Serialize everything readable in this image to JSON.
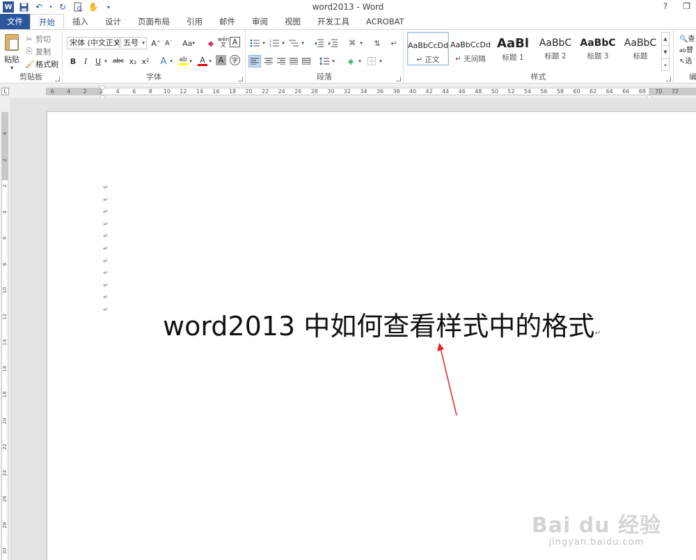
{
  "titlebar": {
    "title": "word2013 - Word",
    "help": "?",
    "restore": "❒",
    "qat_icons": [
      "word-logo",
      "save-icon",
      "undo-icon",
      "redo-icon",
      "print-preview-icon",
      "touch-mode-icon",
      "customize-qat-icon"
    ],
    "word_logo_text": "W"
  },
  "tabs": [
    "文件",
    "开始",
    "插入",
    "设计",
    "页面布局",
    "引用",
    "邮件",
    "审阅",
    "视图",
    "开发工具",
    "ACROBAT"
  ],
  "active_tab": "开始",
  "ribbon": {
    "clipboard": {
      "label": "剪贴板",
      "paste": "粘贴",
      "cut": "剪切",
      "copy": "复制",
      "format_painter": "格式刷"
    },
    "font": {
      "label": "字体",
      "font_name": "宋体 (中文正文",
      "font_size": "五号",
      "grow": "A",
      "shrink": "A",
      "change_case": "Aa",
      "bold": "B",
      "italic": "I",
      "underline": "U",
      "strikethrough": "abc",
      "subscript": "x₂",
      "superscript": "x²",
      "text_effects": "A",
      "highlight": "ab",
      "font_color": "A",
      "char_shading": "A",
      "enclose": "字",
      "phonetic": "wén",
      "char_border": "A",
      "highlight_color": "#ffff00",
      "font_color_value": "#e00000"
    },
    "paragraph": {
      "label": "段落"
    },
    "styles": {
      "label": "样式",
      "items": [
        {
          "sample": "AaBbCcDd",
          "name": "↵ 正文"
        },
        {
          "sample": "AaBbCcDd",
          "name": "↵ 无间隔"
        },
        {
          "sample": "AaBl",
          "name": "标题 1"
        },
        {
          "sample": "AaBbC",
          "name": "标题 2"
        },
        {
          "sample": "AaBbC",
          "name": "标题 3"
        },
        {
          "sample": "AaBbC",
          "name": "标题"
        }
      ]
    },
    "editing": {
      "label": "编",
      "find": "查",
      "replace": "替",
      "select": "选"
    }
  },
  "ruler": {
    "ticks": [
      "6",
      "4",
      "2",
      "2",
      "4",
      "6",
      "8",
      "10",
      "12",
      "14",
      "16",
      "18",
      "20",
      "22",
      "24",
      "26",
      "28",
      "30",
      "32",
      "34",
      "36",
      "38",
      "40",
      "42",
      "44",
      "46",
      "48",
      "50",
      "52",
      "54",
      "56",
      "58",
      "60",
      "62",
      "64",
      "66",
      "68",
      "70",
      "72"
    ],
    "corner": "L"
  },
  "vruler": {
    "ticks": [
      "4",
      "2",
      "2",
      "4",
      "6",
      "8",
      "10",
      "12",
      "14",
      "16",
      "18",
      "20",
      "22",
      "24",
      "26",
      "28",
      "30"
    ]
  },
  "document": {
    "paragraph_marks_count": 11,
    "mark": "↵",
    "headline": "word2013 中如何查看样式中的格式"
  },
  "annotation": {
    "arrow_color": "#e8262a"
  },
  "watermark": {
    "logo": "Bai du 经验",
    "url": "jingyan.baidu.com"
  }
}
